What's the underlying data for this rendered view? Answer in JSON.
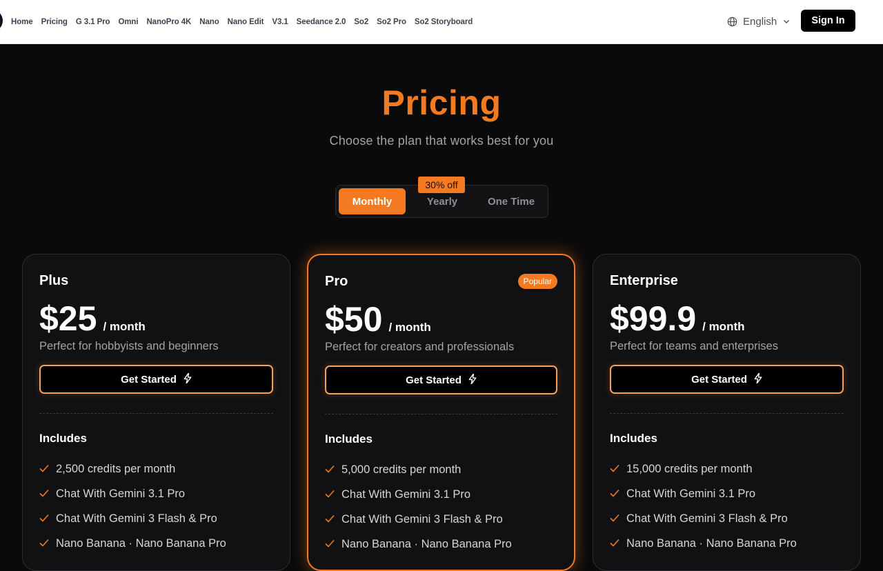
{
  "nav": {
    "items": [
      "Home",
      "Pricing",
      "G 3.1 Pro",
      "Omni",
      "NanoPro 4K",
      "Nano",
      "Nano Edit",
      "V3.1",
      "Seedance 2.0",
      "So2",
      "So2 Pro",
      "So2 Storyboard"
    ],
    "language": "English",
    "sign_in": "Sign In"
  },
  "hero": {
    "title": "Pricing",
    "subtitle": "Choose the plan that works best for you"
  },
  "billing_toggle": {
    "options": [
      "Monthly",
      "Yearly",
      "One Time"
    ],
    "selected": "Monthly",
    "discount_badge": "30% off"
  },
  "plans": [
    {
      "name": "Plus",
      "price": "$25",
      "period": "/ month",
      "description": "Perfect for hobbyists and beginners",
      "cta": "Get Started",
      "includes_label": "Includes",
      "features": [
        "2,500 credits per month",
        "Chat With Gemini 3.1 Pro",
        "Chat With Gemini 3 Flash & Pro",
        "Nano Banana · Nano Banana Pro"
      ]
    },
    {
      "name": "Pro",
      "badge": "Popular",
      "price": "$50",
      "period": "/ month",
      "description": "Perfect for creators and professionals",
      "cta": "Get Started",
      "includes_label": "Includes",
      "features": [
        "5,000 credits per month",
        "Chat With Gemini 3.1 Pro",
        "Chat With Gemini 3 Flash & Pro",
        "Nano Banana · Nano Banana Pro"
      ]
    },
    {
      "name": "Enterprise",
      "price": "$99.9",
      "period": "/ month",
      "description": "Perfect for teams and enterprises",
      "cta": "Get Started",
      "includes_label": "Includes",
      "features": [
        "15,000 credits per month",
        "Chat With Gemini 3.1 Pro",
        "Chat With Gemini 3 Flash & Pro",
        "Nano Banana · Nano Banana Pro"
      ]
    }
  ],
  "colors": {
    "accent": "#f47a21",
    "background": "#0a0a0b",
    "card": "#111114",
    "header": "#ffffff"
  },
  "icons": {
    "language": "globe-icon",
    "dropdown": "chevron-down-icon",
    "cta": "lightning-icon",
    "feature": "check-icon"
  }
}
